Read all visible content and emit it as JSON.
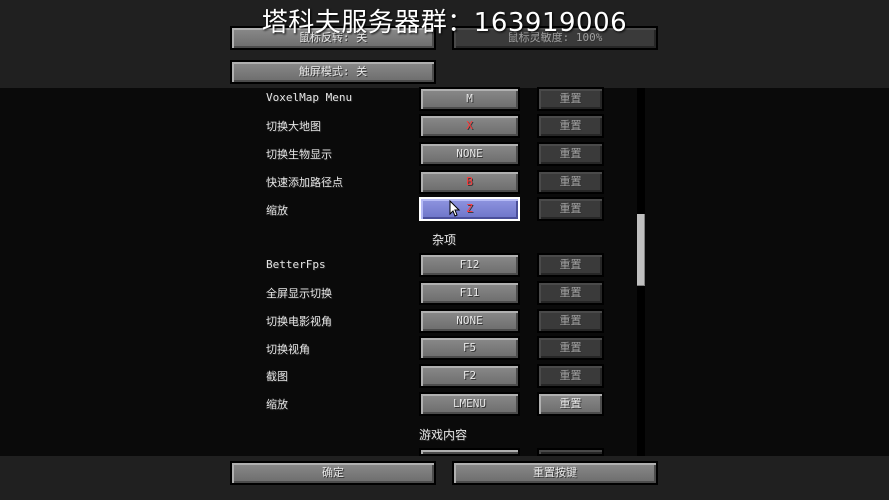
{
  "overlay": {
    "title": "塔科夫服务器群：163919006"
  },
  "top_controls": {
    "mouse_invert": "鼠标反转: 关",
    "mouse_sensitivity": "鼠标灵敏度: 100%",
    "touchscreen_mode": "触屏模式: 关"
  },
  "rows_a": [
    {
      "label": "VoxelMap Menu",
      "key": "M",
      "reset": "重置"
    },
    {
      "label": "切换大地图",
      "key": "X",
      "reset": "重置"
    },
    {
      "label": "切换生物显示",
      "key": "NONE",
      "reset": "重置"
    },
    {
      "label": "快速添加路径点",
      "key": "B",
      "reset": "重置"
    },
    {
      "label": "缩放",
      "key": "Z",
      "reset": "重置"
    }
  ],
  "section_misc": "杂项",
  "rows_b": [
    {
      "label": "BetterFps",
      "key": "F12",
      "reset": "重置"
    },
    {
      "label": "全屏显示切换",
      "key": "F11",
      "reset": "重置"
    },
    {
      "label": "切换电影视角",
      "key": "NONE",
      "reset": "重置"
    },
    {
      "label": "切换视角",
      "key": "F5",
      "reset": "重置"
    },
    {
      "label": "截图",
      "key": "F2",
      "reset": "重置"
    },
    {
      "label": "缩放",
      "key": "LMENU",
      "reset": "重置"
    }
  ],
  "section_gameplay": "游戏内容",
  "bottom": {
    "done": "确定",
    "reset_keys": "重置按键"
  },
  "colors": {
    "conflict_red": "#ff3838",
    "hover_blue": "#7b82d6"
  }
}
